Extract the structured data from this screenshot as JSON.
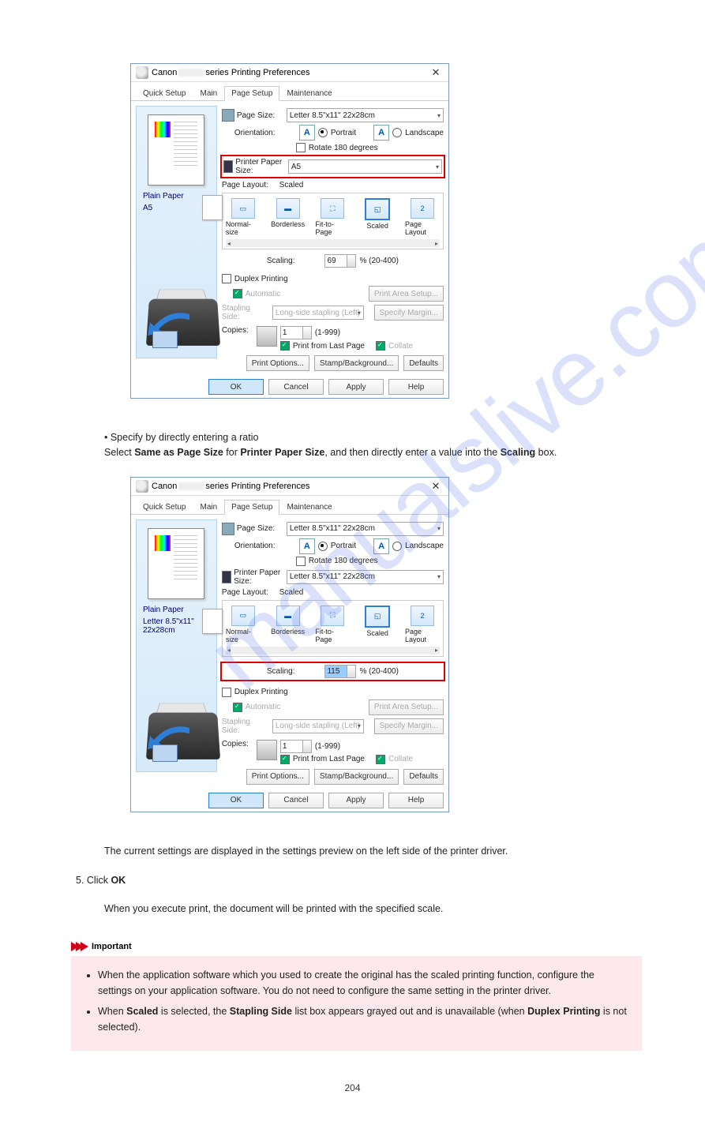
{
  "watermark": "manualslive.com",
  "dialog1": {
    "title_prefix": "Canon",
    "title_suffix": "series Printing Preferences",
    "tabs": [
      "Quick Setup",
      "Main",
      "Page Setup",
      "Maintenance"
    ],
    "active_tab": 2,
    "page_size_label": "Page Size:",
    "page_size_value": "Letter 8.5\"x11\" 22x28cm",
    "orientation_label": "Orientation:",
    "portrait": "Portrait",
    "landscape": "Landscape",
    "rotate180": "Rotate 180 degrees",
    "printer_paper_label": "Printer Paper Size:",
    "printer_paper_value": "A5",
    "page_layout_label": "Page Layout:",
    "page_layout_value": "Scaled",
    "layout_items": [
      "Normal-size",
      "Borderless",
      "Fit-to-Page",
      "Scaled",
      "Page Layout"
    ],
    "layout_selected": 3,
    "layout_pagecount": "2",
    "scaling_label": "Scaling:",
    "scaling_value": "69",
    "scaling_range": "% (20-400)",
    "duplex_label": "Duplex Printing",
    "automatic_label": "Automatic",
    "stapling_label": "Stapling Side:",
    "stapling_value": "Long-side stapling (Left)",
    "print_area_btn": "Print Area Setup...",
    "specify_margin_btn": "Specify Margin...",
    "copies_label": "Copies:",
    "copies_value": "1",
    "copies_range": "(1-999)",
    "print_last": "Print from Last Page",
    "collate": "Collate",
    "print_options_btn": "Print Options...",
    "stamp_btn": "Stamp/Background...",
    "defaults_btn": "Defaults",
    "ok": "OK",
    "cancel": "Cancel",
    "apply": "Apply",
    "help": "Help",
    "media_type": "Plain Paper",
    "media_size": "A5"
  },
  "between_text": "• Specify by directly entering a ratio\nSelect Same as Page Size for Printer Paper Size, and then directly enter a value into the Scaling box.",
  "dialog2": {
    "title_prefix": "Canon",
    "title_suffix": "series Printing Preferences",
    "tabs": [
      "Quick Setup",
      "Main",
      "Page Setup",
      "Maintenance"
    ],
    "active_tab": 2,
    "page_size_label": "Page Size:",
    "page_size_value": "Letter 8.5\"x11\" 22x28cm",
    "orientation_label": "Orientation:",
    "portrait": "Portrait",
    "landscape": "Landscape",
    "rotate180": "Rotate 180 degrees",
    "printer_paper_label": "Printer Paper Size:",
    "printer_paper_value": "Letter 8.5\"x11\" 22x28cm",
    "page_layout_label": "Page Layout:",
    "page_layout_value": "Scaled",
    "layout_items": [
      "Normal-size",
      "Borderless",
      "Fit-to-Page",
      "Scaled",
      "Page Layout"
    ],
    "layout_selected": 3,
    "layout_pagecount": "2",
    "scaling_label": "Scaling:",
    "scaling_value": "115",
    "scaling_range": "% (20-400)",
    "duplex_label": "Duplex Printing",
    "automatic_label": "Automatic",
    "stapling_label": "Stapling Side:",
    "stapling_value": "Long-side stapling (Left)",
    "print_area_btn": "Print Area Setup...",
    "specify_margin_btn": "Specify Margin...",
    "copies_label": "Copies:",
    "copies_value": "1",
    "copies_range": "(1-999)",
    "print_last": "Print from Last Page",
    "collate": "Collate",
    "print_options_btn": "Print Options...",
    "stamp_btn": "Stamp/Background...",
    "defaults_btn": "Defaults",
    "ok": "OK",
    "cancel": "Cancel",
    "apply": "Apply",
    "help": "Help",
    "media_type": "Plain Paper",
    "media_size": "Letter 8.5\"x11\" 22x28cm"
  },
  "after_text": {
    "line1": "The current settings are displayed in the settings preview on the left side of the printer driver.",
    "step": "5. Click OK",
    "line2": "When you execute print, the document will be printed with the specified scale."
  },
  "important": {
    "heading": "Important",
    "items": [
      "When the application software which you used to create the original has the scaled printing function, configure the settings on your application software. You do not need to configure the same setting in the printer driver.",
      "When Scaled is selected, the Stapling Side list box appears grayed out and is unavailable (when Duplex Printing is not selected)."
    ]
  },
  "page_number": "204"
}
